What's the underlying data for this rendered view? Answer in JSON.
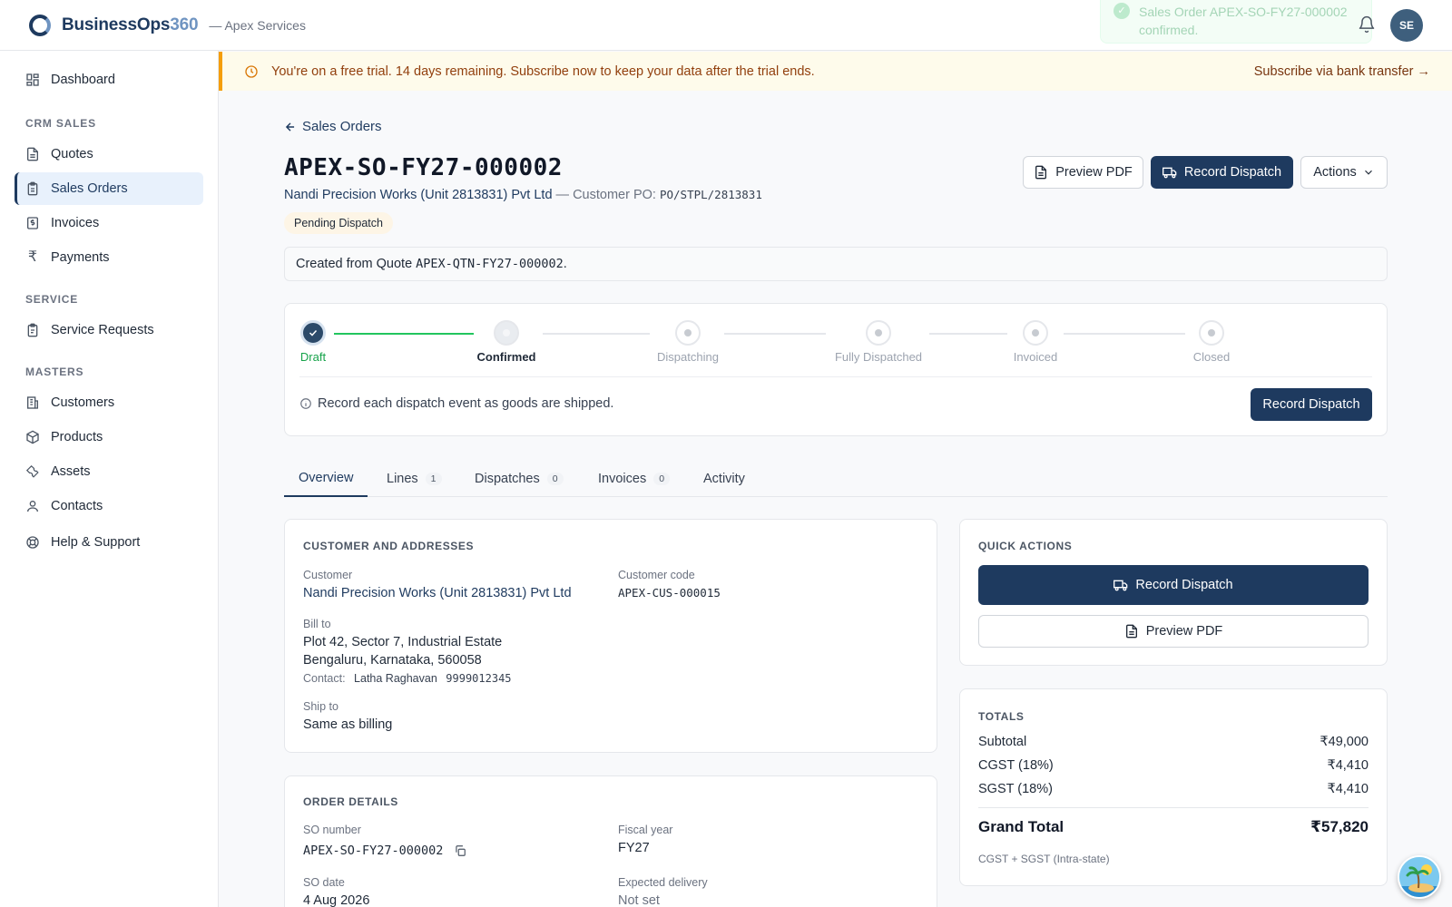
{
  "header": {
    "brand_name": "BusinessOps",
    "brand_number": "360",
    "org": "— Apex Services",
    "toast": "Sales Order APEX-SO-FY27-000002 confirmed.",
    "avatar_initials": "SE"
  },
  "sidebar": {
    "dashboard": "Dashboard",
    "section_crm": "CRM SALES",
    "quotes": "Quotes",
    "sales_orders": "Sales Orders",
    "invoices": "Invoices",
    "payments": "Payments",
    "section_service": "SERVICE",
    "service_requests": "Service Requests",
    "section_masters": "MASTERS",
    "customers": "Customers",
    "products": "Products",
    "assets": "Assets",
    "contacts": "Contacts",
    "help": "Help & Support"
  },
  "banner": {
    "text": "You're on a free trial. 14 days remaining. Subscribe now to keep your data after the trial ends.",
    "link": "Subscribe via bank transfer →"
  },
  "page": {
    "back_label": "Sales Orders",
    "so_number": "APEX-SO-FY27-000002",
    "customer_name": "Nandi Precision Works (Unit 2813831) Pvt Ltd",
    "customer_po_label": "— Customer PO:",
    "customer_po": "PO/STPL/2813831",
    "status": "Pending Dispatch",
    "preview_pdf": "Preview PDF",
    "record_dispatch": "Record Dispatch",
    "actions": "Actions",
    "quote_prefix": "Created from Quote",
    "quote_number": "APEX-QTN-FY27-000002",
    "quote_suffix": "."
  },
  "progress": {
    "steps": [
      "Draft",
      "Confirmed",
      "Dispatching",
      "Fully Dispatched",
      "Invoiced",
      "Closed"
    ],
    "current_step": "Confirmed",
    "note": "Record each dispatch event as goods are shipped.",
    "button": "Record Dispatch"
  },
  "tabs": [
    {
      "label": "Overview",
      "count": null
    },
    {
      "label": "Lines",
      "count": "1"
    },
    {
      "label": "Dispatches",
      "count": "0"
    },
    {
      "label": "Invoices",
      "count": "0"
    },
    {
      "label": "Activity",
      "count": null
    }
  ],
  "customer_card": {
    "title": "CUSTOMER AND ADDRESSES",
    "customer_label": "Customer",
    "customer_value": "Nandi Precision Works (Unit 2813831) Pvt Ltd",
    "code_label": "Customer code",
    "code_value": "APEX-CUS-000015",
    "bill_label": "Bill to",
    "bill_line1": "Plot 42, Sector 7, Industrial Estate",
    "bill_line2": "Bengaluru, Karnataka, 560058",
    "contact_label": "Contact:",
    "contact_name": "Latha Raghavan",
    "contact_phone": "9999012345",
    "ship_label": "Ship to",
    "ship_value": "Same as billing"
  },
  "order_card": {
    "title": "ORDER DETAILS",
    "so_label": "SO number",
    "so_value": "APEX-SO-FY27-000002",
    "fy_label": "Fiscal year",
    "fy_value": "FY27",
    "date_label": "SO date",
    "date_value": "4 Aug 2026",
    "delivery_label": "Expected delivery",
    "delivery_value": "Not set"
  },
  "quick_actions": {
    "title": "QUICK ACTIONS",
    "record_dispatch": "Record Dispatch",
    "preview_pdf": "Preview PDF"
  },
  "totals": {
    "title": "TOTALS",
    "subtotal_label": "Subtotal",
    "subtotal": "₹49,000",
    "cgst_label": "CGST (18%)",
    "cgst": "₹4,410",
    "sgst_label": "SGST (18%)",
    "sgst": "₹4,410",
    "grand_label": "Grand Total",
    "grand": "₹57,820",
    "note": "CGST + SGST (Intra-state)"
  },
  "colors": {
    "primary": "#1e3a5f",
    "accent": "#6f94c1",
    "success": "#22c55e",
    "warning": "#f59e0b"
  }
}
